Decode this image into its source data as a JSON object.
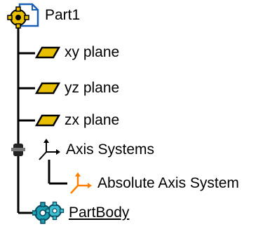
{
  "tree": {
    "root": {
      "label": "Part1",
      "icon": "part-document-icon"
    },
    "planes": [
      {
        "label": "xy plane",
        "icon": "plane-icon"
      },
      {
        "label": "yz plane",
        "icon": "plane-icon"
      },
      {
        "label": "zx plane",
        "icon": "plane-icon"
      }
    ],
    "axis_systems": {
      "label": "Axis Systems",
      "icon": "axis-system-icon"
    },
    "absolute_axis": {
      "label": "Absolute Axis System",
      "icon": "axis-system-icon"
    },
    "part_body": {
      "label": "PartBody",
      "icon": "part-body-gear-icon"
    }
  },
  "colors": {
    "plane_fill": "#e8c000",
    "axis_orange": "#ff8000",
    "gear_teal": "#1aa0b0",
    "tree_line": "#000000"
  }
}
